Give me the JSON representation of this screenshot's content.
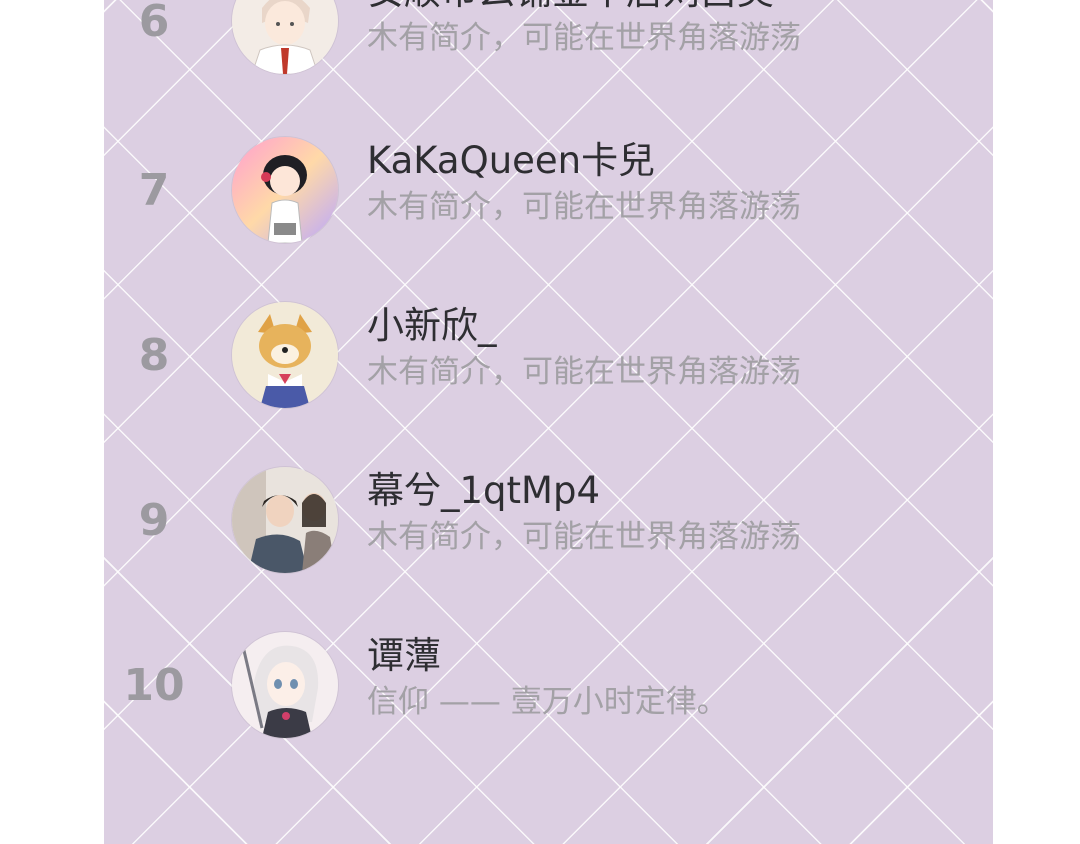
{
  "ranking": {
    "items": [
      {
        "rank": "6",
        "name": "安顺市么铺金平居刘吕美",
        "bio": "木有简介，可能在世界角落游荡",
        "avatar_icon": "anime-boy-avatar-icon"
      },
      {
        "rank": "7",
        "name": "KaKaQueen卡兒",
        "bio": "木有简介，可能在世界角落游荡",
        "avatar_icon": "cartoon-girl-avatar-icon"
      },
      {
        "rank": "8",
        "name": "小新欣_",
        "bio": "木有简介，可能在世界角落游荡",
        "avatar_icon": "shiba-dog-avatar-icon"
      },
      {
        "rank": "9",
        "name": "幕兮_1qtMp4",
        "bio": "木有简介，可能在世界角落游荡",
        "avatar_icon": "photo-avatar-icon"
      },
      {
        "rank": "10",
        "name": "谭藫",
        "bio": "信仰 —— 壹万小时定律。",
        "avatar_icon": "anime-girl-avatar-icon"
      }
    ]
  },
  "colors": {
    "panel_background": "#dccfe2",
    "rank_text": "#9c9aa0",
    "name_text": "#2e2e32",
    "bio_text": "#a3a1a6"
  }
}
